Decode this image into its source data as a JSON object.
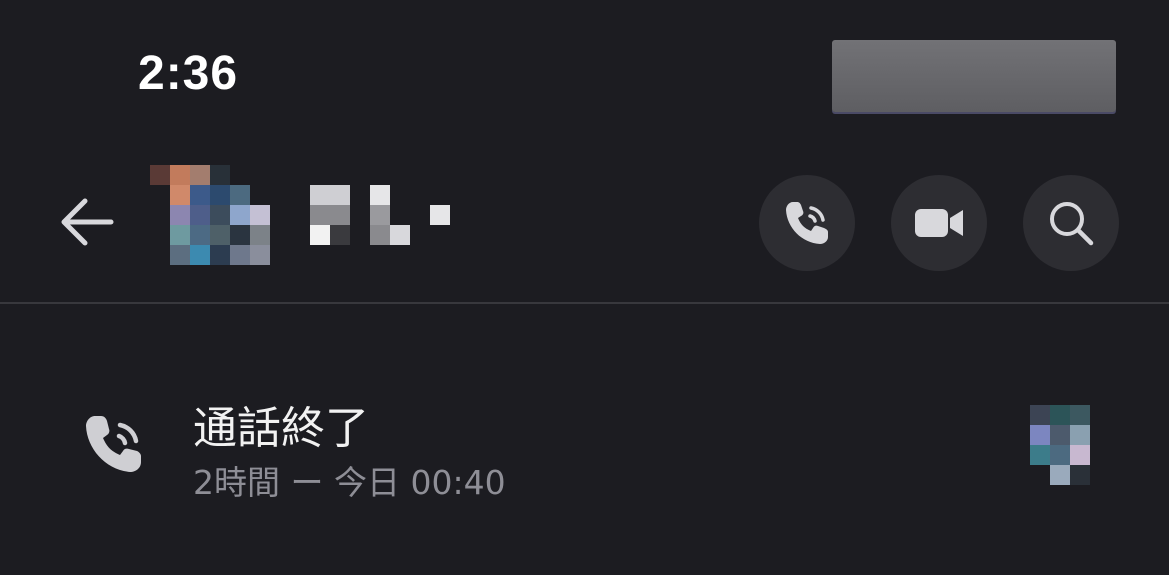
{
  "status_bar": {
    "time": "2:36"
  },
  "header": {
    "back_icon": "arrow-left-icon",
    "avatar_icon": "avatar-pixelated",
    "name_icon": "pixelated-name",
    "actions": [
      {
        "icon": "phone-icon"
      },
      {
        "icon": "video-camera-icon"
      },
      {
        "icon": "search-icon"
      }
    ]
  },
  "call_log": {
    "title": "通話終了",
    "detail": "2時間 ー 今日 00:40"
  },
  "colors": {
    "background": "#1c1c21",
    "button_bg": "#2d2d32",
    "icon": "#d8d8dc",
    "secondary_text": "#8e8e96"
  }
}
